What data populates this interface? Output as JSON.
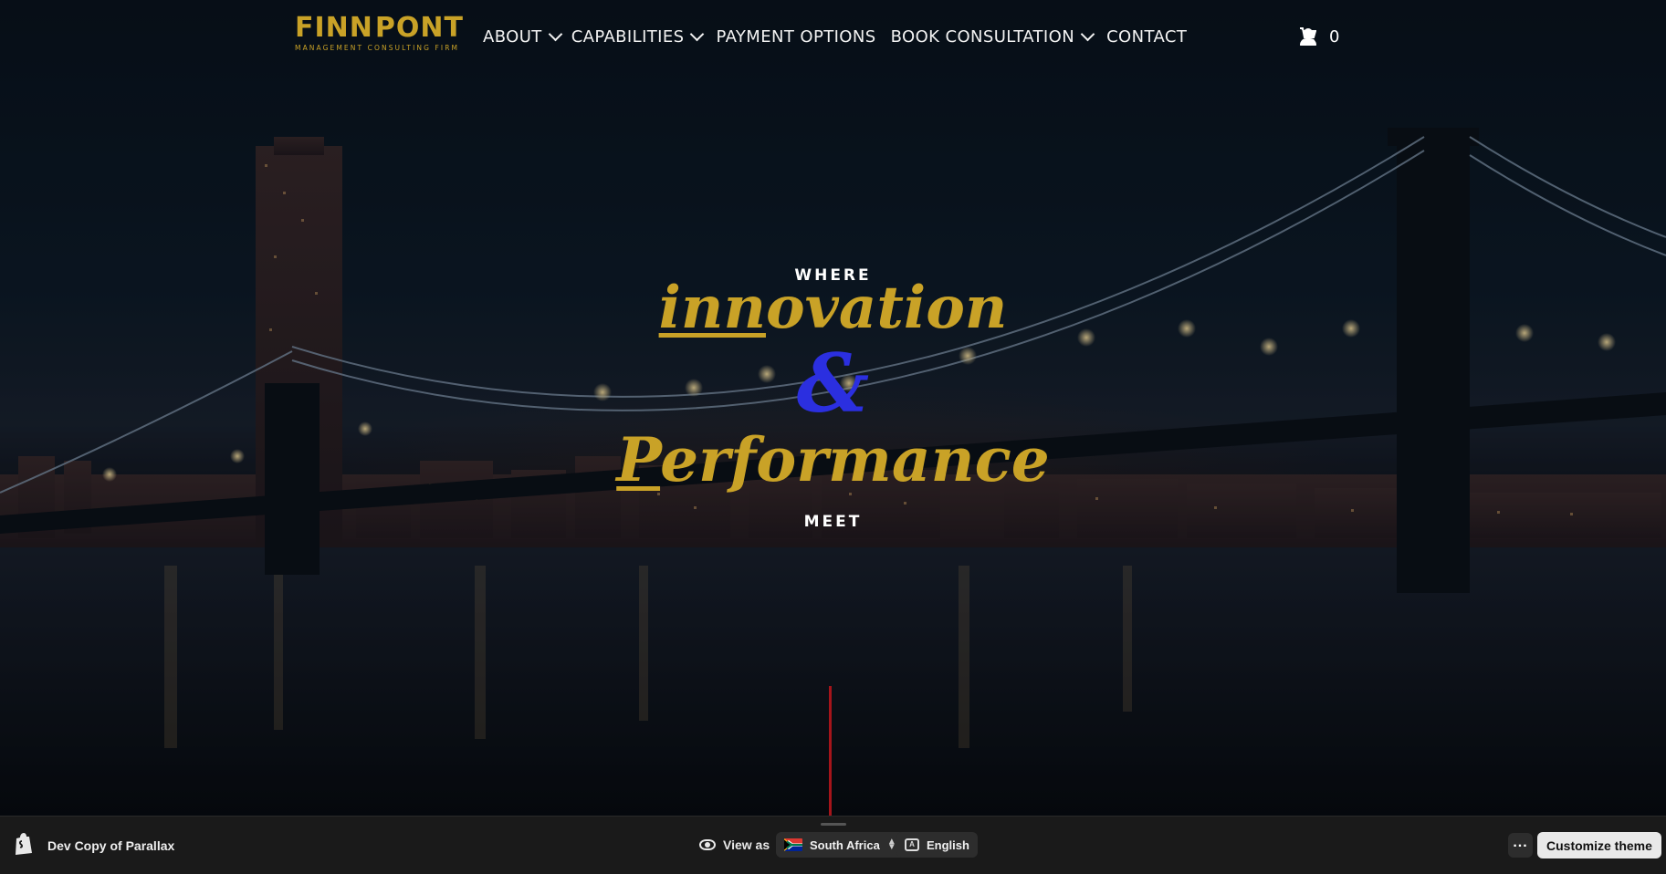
{
  "header": {
    "logo": {
      "wordmark_left": "FINN",
      "wordmark_right": "PONT",
      "tagline": "MANAGEMENT CONSULTING FIRM"
    },
    "nav": [
      {
        "label": "ABOUT",
        "dropdown": true
      },
      {
        "label": "CAPABILITIES",
        "dropdown": true
      },
      {
        "label": "PAYMENT OPTIONS",
        "dropdown": false
      },
      {
        "label": "BOOK CONSULTATION",
        "dropdown": true
      },
      {
        "label": "CONTACT",
        "dropdown": false
      }
    ],
    "account_icon": "user-icon",
    "cart_icon": "cart-icon",
    "cart_count": "0"
  },
  "hero": {
    "kicker_top": "WHERE",
    "line1": "innovation",
    "ampersand": "&",
    "line2": "Performance",
    "kicker_bottom": "MEET",
    "background": "night city skyline with suspension bridge over river"
  },
  "preview_bar": {
    "store_name": "Dev Copy of Parallax",
    "view_as_label": "View as",
    "country": "South Africa",
    "language": "English",
    "more_label": "...",
    "customize_label": "Customize theme"
  },
  "colors": {
    "gold": "#c9a227",
    "blue_accent": "#2b2fe0",
    "scroll_line": "#a5141a",
    "bar_bg": "#1a1a1a"
  }
}
